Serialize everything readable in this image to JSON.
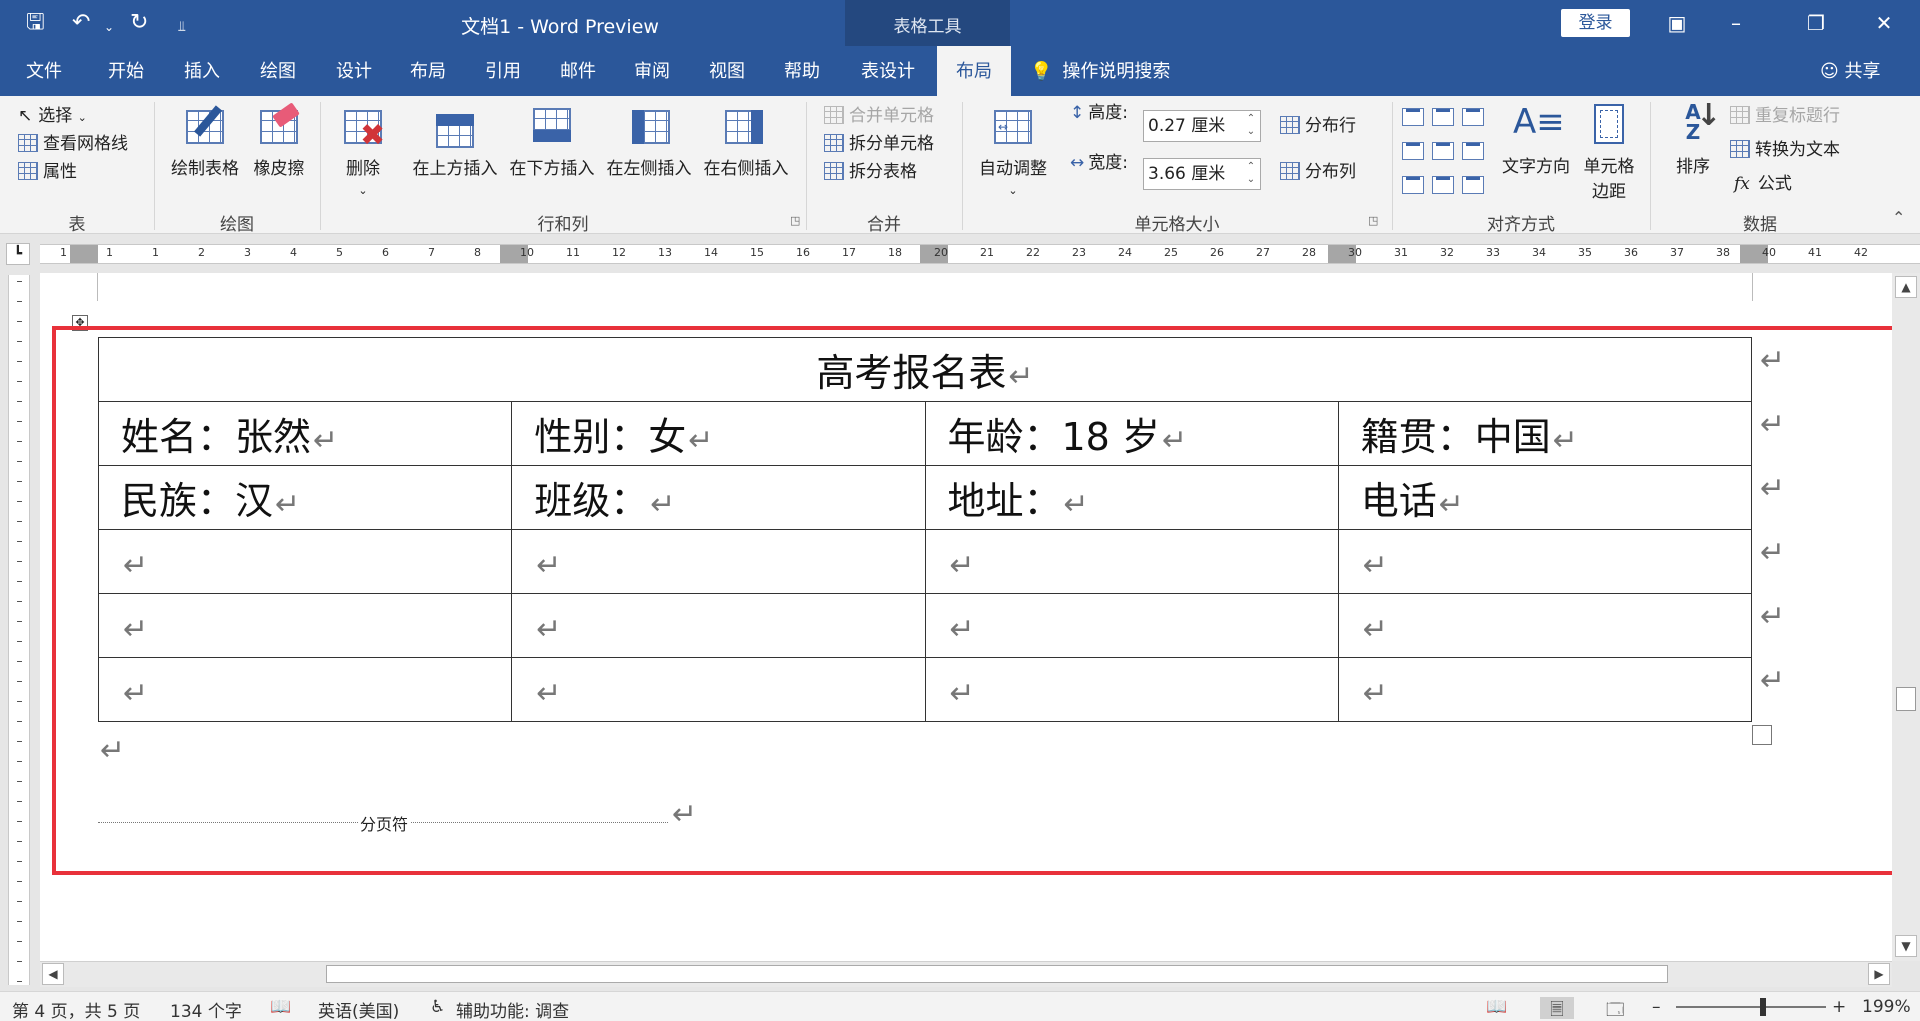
{
  "window": {
    "doc_title": "文档1  -  Word Preview",
    "tools_label": "表格工具",
    "login": "登录"
  },
  "tabs": [
    {
      "label": "文件"
    },
    {
      "label": "开始"
    },
    {
      "label": "插入"
    },
    {
      "label": "绘图"
    },
    {
      "label": "设计"
    },
    {
      "label": "布局"
    },
    {
      "label": "引用"
    },
    {
      "label": "邮件"
    },
    {
      "label": "审阅"
    },
    {
      "label": "视图"
    },
    {
      "label": "帮助"
    },
    {
      "label": "表设计"
    },
    {
      "label": "布局"
    }
  ],
  "search_tab": "操作说明搜索",
  "share": "共享",
  "ribbon": {
    "table": {
      "select": "选择",
      "gridlines": "查看网格线",
      "properties": "属性",
      "label": "表"
    },
    "draw": {
      "draw_table": "绘制表格",
      "eraser": "橡皮擦",
      "label": "绘图"
    },
    "rows_cols": {
      "delete": "删除",
      "insert_above": "在上方插入",
      "insert_below": "在下方插入",
      "insert_left": "在左侧插入",
      "insert_right": "在右侧插入",
      "label": "行和列"
    },
    "merge": {
      "merge_cells": "合并单元格",
      "split_cells": "拆分单元格",
      "split_table": "拆分表格",
      "label": "合并"
    },
    "cell_size": {
      "autofit": "自动调整",
      "height_label": "高度:",
      "height_value": "0.27 厘米",
      "width_label": "宽度:",
      "width_value": "3.66 厘米",
      "distribute_rows": "分布行",
      "distribute_cols": "分布列",
      "label": "单元格大小"
    },
    "alignment": {
      "text_direction": "文字方向",
      "cell_margins_1": "单元格",
      "cell_margins_2": "边距",
      "label": "对齐方式"
    },
    "data": {
      "sort": "排序",
      "repeat_header": "重复标题行",
      "convert_text": "转换为文本",
      "formula": "公式",
      "label": "数据"
    }
  },
  "ruler_numbers": [
    "1",
    "1",
    "1",
    "2",
    "3",
    "4",
    "5",
    "6",
    "7",
    "8",
    "10",
    "11",
    "12",
    "13",
    "14",
    "15",
    "16",
    "17",
    "18",
    "20",
    "21",
    "22",
    "23",
    "24",
    "25",
    "26",
    "27",
    "28",
    "30",
    "31",
    "32",
    "33",
    "34",
    "35",
    "36",
    "37",
    "38",
    "40",
    "41",
    "42"
  ],
  "document": {
    "title": "高考报名表",
    "rows": [
      [
        "姓名：张然",
        "性别：女",
        "年龄：18 岁",
        "籍贯：中国"
      ],
      [
        "民族：汉",
        "班级：",
        "地址：",
        "电话"
      ],
      [
        "",
        "",
        "",
        ""
      ],
      [
        "",
        "",
        "",
        ""
      ],
      [
        "",
        "",
        "",
        ""
      ]
    ],
    "paragraph_mark": "↵",
    "page_break": "分页符"
  },
  "status": {
    "page": "第 4 页，共 5 页",
    "words": "134 个字",
    "language": "英语(美国)",
    "accessibility": "辅助功能: 调查",
    "zoom": "199%"
  },
  "colors": {
    "brand": "#2b579a",
    "highlight": "#e8313a"
  }
}
